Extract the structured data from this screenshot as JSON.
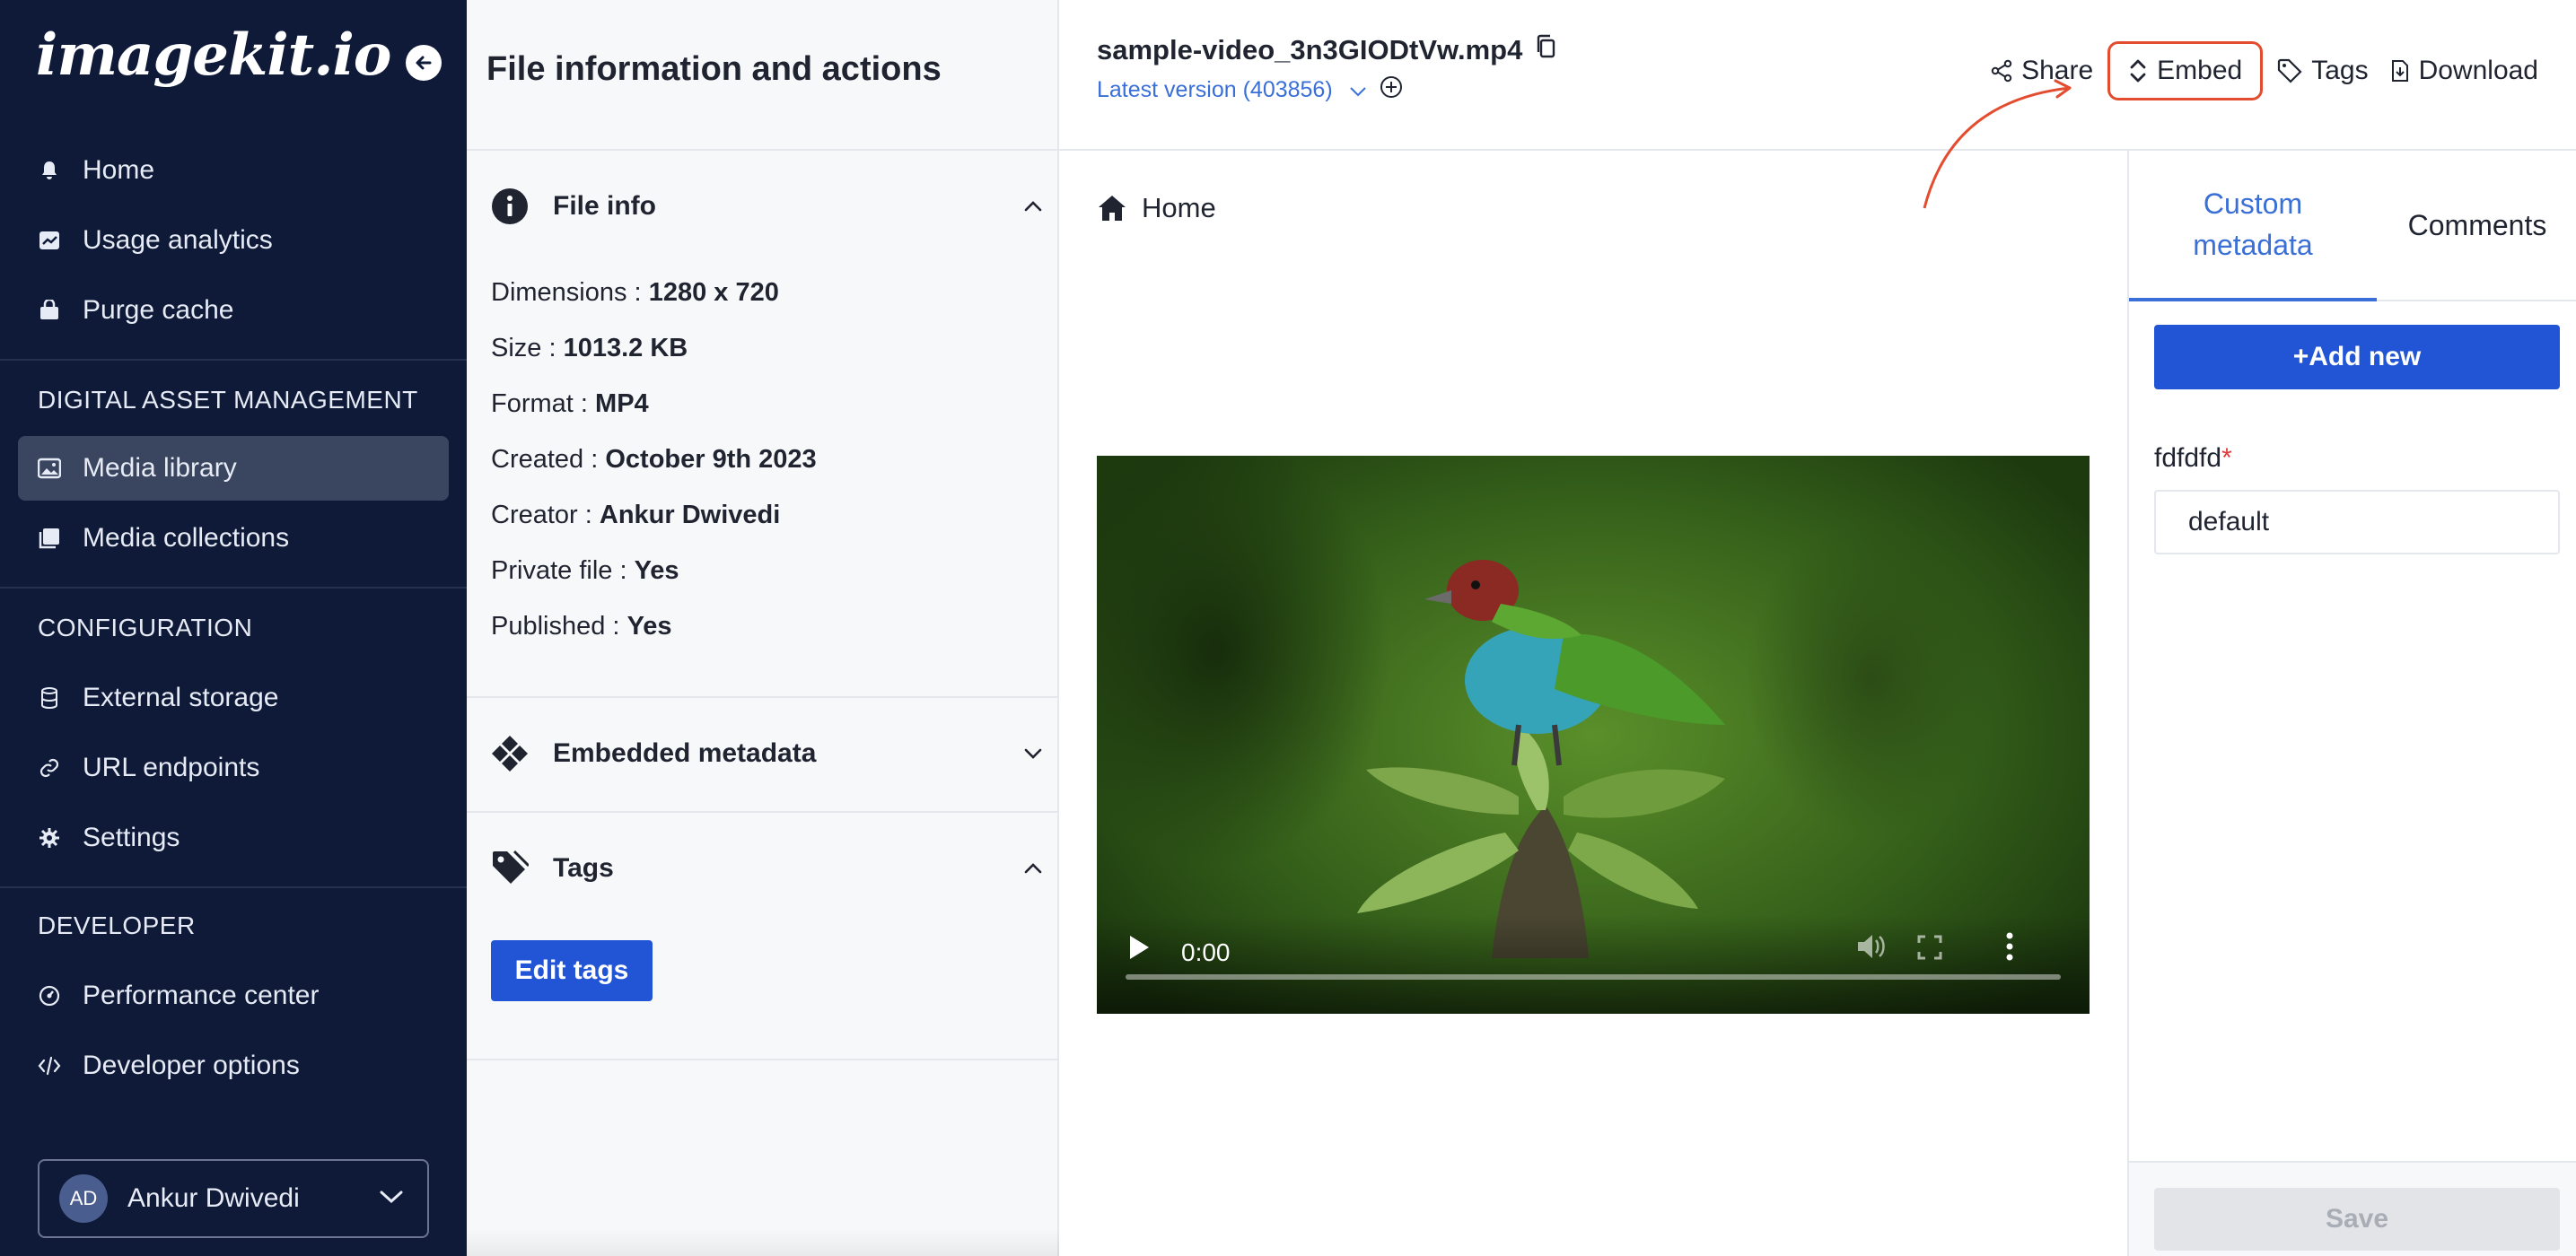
{
  "sidebar": {
    "logo": "imagekit.io",
    "top_items": [
      {
        "label": "Home",
        "icon": "bell-icon"
      },
      {
        "label": "Usage analytics",
        "icon": "chart-icon"
      },
      {
        "label": "Purge cache",
        "icon": "basket-icon"
      }
    ],
    "sections": [
      {
        "title": "DIGITAL ASSET MANAGEMENT",
        "items": [
          {
            "label": "Media library",
            "icon": "image-icon",
            "active": true
          },
          {
            "label": "Media collections",
            "icon": "collection-icon"
          }
        ]
      },
      {
        "title": "CONFIGURATION",
        "items": [
          {
            "label": "External storage",
            "icon": "database-icon"
          },
          {
            "label": "URL endpoints",
            "icon": "link-icon"
          },
          {
            "label": "Settings",
            "icon": "gear-icon"
          }
        ]
      },
      {
        "title": "DEVELOPER",
        "items": [
          {
            "label": "Performance center",
            "icon": "gauge-icon"
          },
          {
            "label": "Developer options",
            "icon": "code-icon"
          }
        ]
      }
    ],
    "user": {
      "initials": "AD",
      "name": "Ankur Dwivedi"
    }
  },
  "info_panel": {
    "title": "File information and actions",
    "file_info": {
      "title": "File info",
      "rows": [
        {
          "label": "Dimensions :",
          "value": "1280 x 720"
        },
        {
          "label": "Size :",
          "value": "1013.2 KB"
        },
        {
          "label": "Format :",
          "value": "MP4"
        },
        {
          "label": "Created :",
          "value": "October 9th 2023"
        },
        {
          "label": "Creator :",
          "value": "Ankur Dwivedi"
        },
        {
          "label": "Private file :",
          "value": "Yes"
        },
        {
          "label": "Published :",
          "value": "Yes"
        }
      ]
    },
    "embedded_metadata": {
      "title": "Embedded metadata"
    },
    "tags": {
      "title": "Tags",
      "edit_label": "Edit tags"
    }
  },
  "header": {
    "file_name": "sample-video_3n3GIODtVw.mp4",
    "version": "Latest version (403856)",
    "actions": {
      "share": "Share",
      "embed": "Embed",
      "tags": "Tags",
      "download": "Download"
    }
  },
  "breadcrumb": {
    "home": "Home"
  },
  "video": {
    "time": "0:00",
    "progress": 0
  },
  "meta_panel": {
    "tab_custom_line1": "Custom",
    "tab_custom_line2": "metadata",
    "tab_comments": "Comments",
    "add_new": "+Add new",
    "field_label": "fdfdfd",
    "field_required": "*",
    "field_value": "default",
    "save": "Save"
  },
  "colors": {
    "sidebar_bg": "#0e1a38",
    "primary": "#2155d6",
    "link": "#3a6fd8",
    "annotation": "#e34c2f"
  }
}
